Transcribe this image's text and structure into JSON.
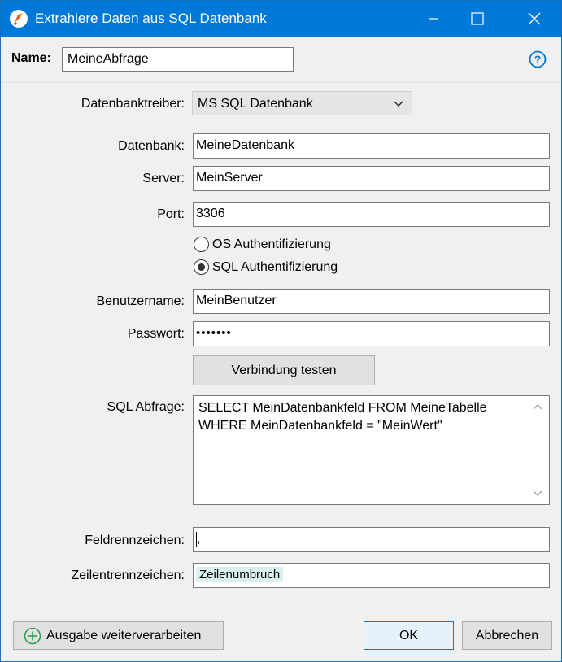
{
  "window": {
    "title": "Extrahiere Daten aus SQL Datenbank"
  },
  "namebar": {
    "label": "Name:",
    "value": "MeineAbfrage",
    "help_icon": "help-circle-icon"
  },
  "form": {
    "driver_label": "Datenbanktreiber:",
    "driver_value": "MS SQL Datenbank",
    "database_label": "Datenbank:",
    "database_value": "MeineDatenbank",
    "server_label": "Server:",
    "server_value": "MeinServer",
    "port_label": "Port:",
    "port_value": "3306",
    "auth_options": [
      {
        "label": "OS Authentifizierung",
        "selected": false
      },
      {
        "label": "SQL Authentifizierung",
        "selected": true
      }
    ],
    "username_label": "Benutzername:",
    "username_value": "MeinBenutzer",
    "password_label": "Passwort:",
    "password_value": "•••••••",
    "test_button": "Verbindung testen",
    "sql_label": "SQL Abfrage:",
    "sql_line1": "SELECT MeinDatenbankfeld FROM MeineTabelle",
    "sql_line2": "WHERE MeinDatenbankfeld = \"MeinWert\"",
    "field_sep_label": "Feldrennzeichen:",
    "field_sep_value": ",",
    "row_sep_label": "Zeilentrennzeichen:",
    "row_sep_value": "Zeilenumbruch"
  },
  "footer": {
    "process_button": "Ausgabe weiterverarbeiten",
    "ok_button": "OK",
    "cancel_button": "Abbrechen"
  },
  "colors": {
    "titlebar": "#0078d7",
    "help": "#0078d7",
    "add_icon": "#2e9e4f",
    "chip": "#d9f2ef"
  }
}
